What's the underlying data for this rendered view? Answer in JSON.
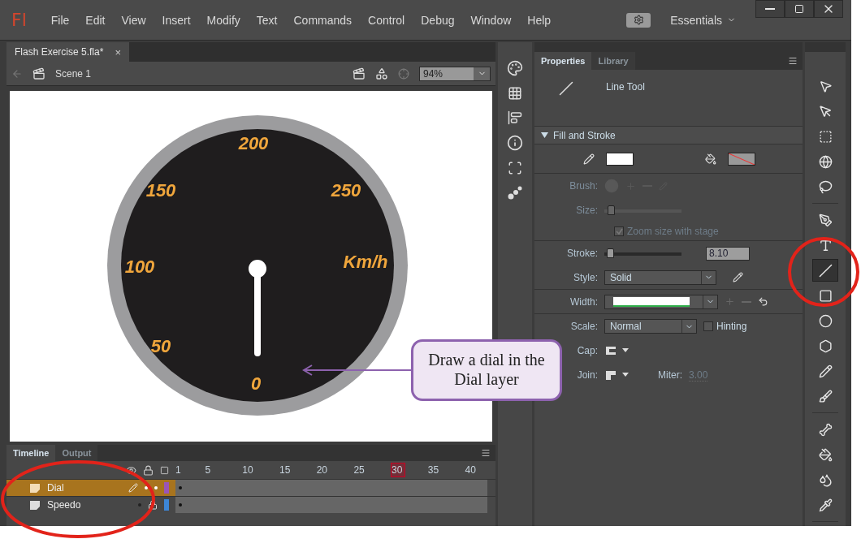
{
  "app": {
    "logo": "Fl",
    "menu": [
      "File",
      "Edit",
      "View",
      "Insert",
      "Modify",
      "Text",
      "Commands",
      "Control",
      "Debug",
      "Window",
      "Help"
    ],
    "workspace": "Essentials"
  },
  "document": {
    "tab": {
      "title": "Flash Exercise 5.fla*",
      "close": "×"
    },
    "scene": "Scene 1",
    "zoom": "94%"
  },
  "stage": {
    "dial_labels": [
      "200",
      "150",
      "250",
      "100",
      "Km/h",
      "50",
      "0"
    ],
    "callout": "Draw a dial in the Dial layer"
  },
  "timeline": {
    "tabs": [
      {
        "label": "Timeline",
        "selected": true
      },
      {
        "label": "Output",
        "selected": false
      }
    ],
    "frame_numbers": [
      {
        "label": "1",
        "selected": false
      },
      {
        "label": "5",
        "selected": false
      },
      {
        "label": "10",
        "selected": false
      },
      {
        "label": "15",
        "selected": false
      },
      {
        "label": "20",
        "selected": false
      },
      {
        "label": "25",
        "selected": false
      },
      {
        "label": "30",
        "selected": true
      },
      {
        "label": "35",
        "selected": false
      },
      {
        "label": "40",
        "selected": false
      }
    ],
    "layers": [
      {
        "name": "Dial",
        "selected": true,
        "color": "#9a55b8",
        "locked": false,
        "editing": true
      },
      {
        "name": "Speedo",
        "selected": false,
        "color": "#3c86d8",
        "locked": true,
        "editing": false
      }
    ]
  },
  "properties": {
    "tabs": [
      {
        "label": "Properties",
        "selected": true
      },
      {
        "label": "Library",
        "selected": false
      }
    ],
    "tool": "Line Tool",
    "section": {
      "title": "Fill and Stroke",
      "expanded": true
    },
    "brush_label": "Brush:",
    "size_label": "Size:",
    "size_slider": {
      "level": 0.05,
      "disabled": true
    },
    "zoom_checkbox": {
      "label": "Zoom size with stage",
      "checked": true,
      "disabled": true
    },
    "stroke": {
      "label": "Stroke:",
      "level": 0.03,
      "value": "8.10"
    },
    "style": {
      "label": "Style:",
      "value": "Solid"
    },
    "width_label": "Width:",
    "scale": {
      "label": "Scale:",
      "value": "Normal"
    },
    "hinting": {
      "label": "Hinting",
      "checked": false
    },
    "cap_label": "Cap:",
    "join_label": "Join:",
    "miter": {
      "label": "Miter:",
      "value": "3.00"
    }
  },
  "tool_groups": [
    [
      {
        "kind": "selection",
        "selected": false
      },
      {
        "kind": "subselection",
        "selected": false
      },
      {
        "kind": "transform",
        "selected": false
      },
      {
        "kind": "rotate3d",
        "selected": false
      },
      {
        "kind": "lasso",
        "selected": false
      }
    ],
    [
      {
        "kind": "pen",
        "selected": false
      },
      {
        "kind": "text",
        "selected": false
      },
      {
        "kind": "line",
        "selected": true
      },
      {
        "kind": "rectangle",
        "selected": false
      },
      {
        "kind": "oval",
        "selected": false
      },
      {
        "kind": "polystar",
        "selected": false
      },
      {
        "kind": "pencil",
        "selected": false
      },
      {
        "kind": "brush",
        "selected": false
      }
    ],
    [
      {
        "kind": "bone",
        "selected": false
      },
      {
        "kind": "bucket",
        "selected": false
      },
      {
        "kind": "inkbottle",
        "selected": false
      },
      {
        "kind": "eyedropper",
        "selected": false
      }
    ]
  ]
}
